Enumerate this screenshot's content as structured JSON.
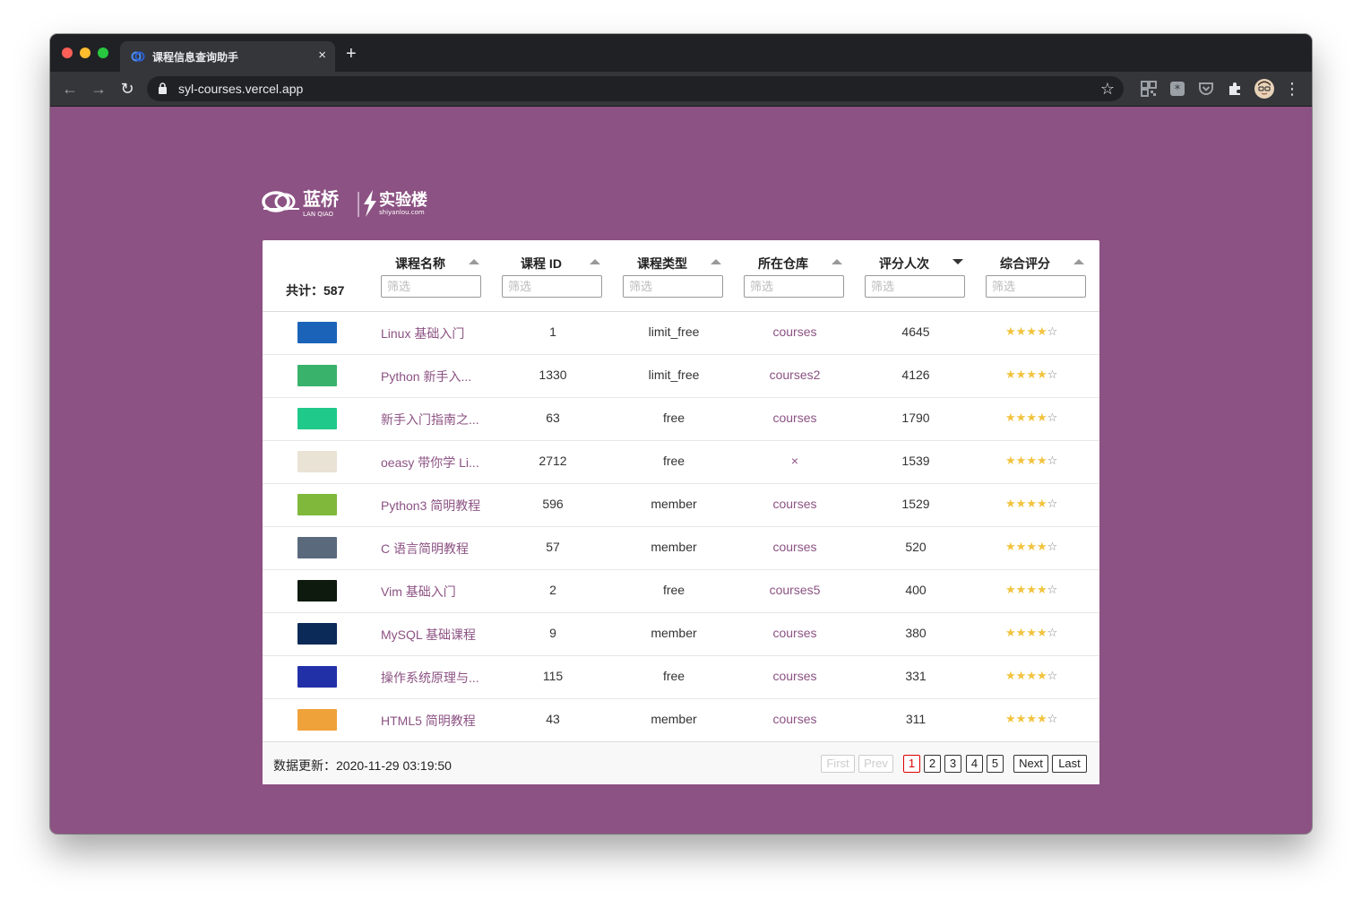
{
  "browser": {
    "tab_title": "课程信息查询助手",
    "tab_close": "×",
    "new_tab": "+",
    "url": "syl-courses.vercel.app"
  },
  "logo": {
    "lanqiao_cn": "蓝桥",
    "lanqiao_en": "LAN QIAO",
    "shiyanlou_cn": "实验楼",
    "shiyanlou_en": "shiyanlou.com"
  },
  "table": {
    "total_label": "共计：587",
    "filter_placeholder": "筛选",
    "columns": [
      {
        "label": "课程名称",
        "sort": "asc"
      },
      {
        "label": "课程 ID",
        "sort": "asc"
      },
      {
        "label": "课程类型",
        "sort": "asc"
      },
      {
        "label": "所在仓库",
        "sort": "asc"
      },
      {
        "label": "评分人次",
        "sort": "desc"
      },
      {
        "label": "综合评分",
        "sort": "asc"
      }
    ],
    "rows": [
      {
        "thumb_color": "#1b63b8",
        "name": "Linux 基础入门",
        "id": "1",
        "type": "limit_free",
        "repo": "courses",
        "count": "4645",
        "rating": 4
      },
      {
        "thumb_color": "#39b36b",
        "name": "Python 新手入...",
        "id": "1330",
        "type": "limit_free",
        "repo": "courses2",
        "count": "4126",
        "rating": 4
      },
      {
        "thumb_color": "#1fc98a",
        "name": "新手入门指南之...",
        "id": "63",
        "type": "free",
        "repo": "courses",
        "count": "1790",
        "rating": 4
      },
      {
        "thumb_color": "#e9e3d6",
        "name": "oeasy 带你学 Li...",
        "id": "2712",
        "type": "free",
        "repo": "×",
        "count": "1539",
        "rating": 4
      },
      {
        "thumb_color": "#7fb83a",
        "name": "Python3 简明教程",
        "id": "596",
        "type": "member",
        "repo": "courses",
        "count": "1529",
        "rating": 4
      },
      {
        "thumb_color": "#5a6a7c",
        "name": "C 语言简明教程",
        "id": "57",
        "type": "member",
        "repo": "courses",
        "count": "520",
        "rating": 4
      },
      {
        "thumb_color": "#0d1a0d",
        "name": "Vim 基础入门",
        "id": "2",
        "type": "free",
        "repo": "courses5",
        "count": "400",
        "rating": 4
      },
      {
        "thumb_color": "#0b2a57",
        "name": "MySQL 基础课程",
        "id": "9",
        "type": "member",
        "repo": "courses",
        "count": "380",
        "rating": 4
      },
      {
        "thumb_color": "#2230a8",
        "name": "操作系统原理与...",
        "id": "115",
        "type": "free",
        "repo": "courses",
        "count": "331",
        "rating": 4
      },
      {
        "thumb_color": "#f0a23a",
        "name": "HTML5 简明教程",
        "id": "43",
        "type": "member",
        "repo": "courses",
        "count": "311",
        "rating": 4
      }
    ]
  },
  "footer": {
    "update_label": "数据更新：2020-11-29 03:19:50",
    "first": "First",
    "prev": "Prev",
    "pages": [
      "1",
      "2",
      "3",
      "4",
      "5"
    ],
    "next": "Next",
    "last": "Last"
  },
  "colors": {
    "page_background": "#8c5283",
    "link": "#8c5283",
    "star_on": "#f2c33c",
    "active_page": "#dd0000"
  }
}
